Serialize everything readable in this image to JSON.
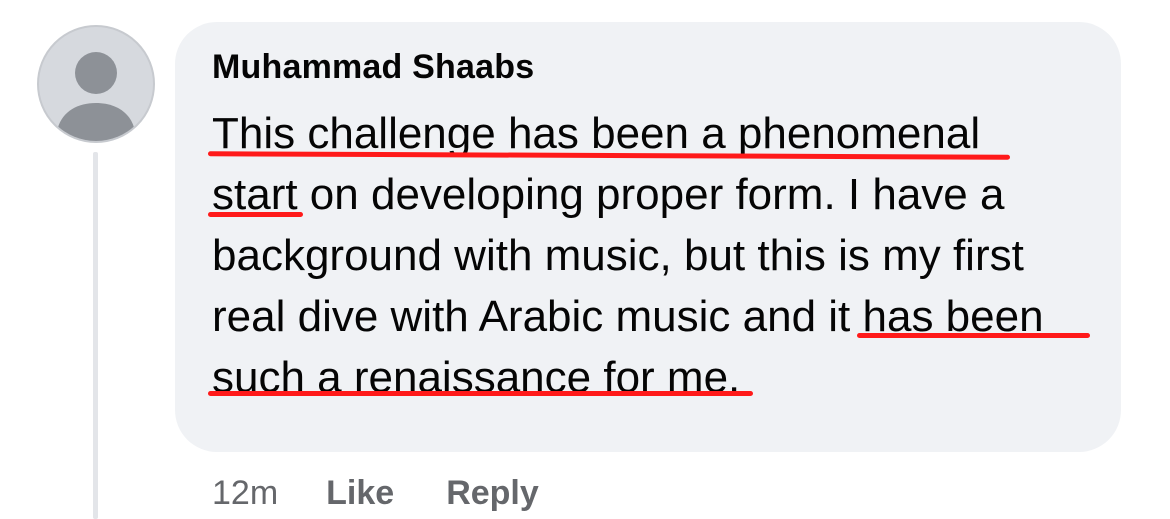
{
  "comment": {
    "author": "Muhammad Shaabs",
    "text_lines": [
      "This challenge has been a phenomenal",
      "start",
      " on developing proper form. I have a",
      "background with music, but this is my first",
      "real dive with Arabic music and ",
      "it has been",
      "such a renaissance for me",
      "."
    ],
    "highlight_color": "#ff1a1a"
  },
  "actions": {
    "timestamp": "12m",
    "like_label": "Like",
    "reply_label": "Reply"
  },
  "colors": {
    "bubble": "#f0f2f5",
    "text": "#050505",
    "secondary_text": "#65676b",
    "avatar": "#d6d9de",
    "avatar_figure": "#8d9197"
  }
}
